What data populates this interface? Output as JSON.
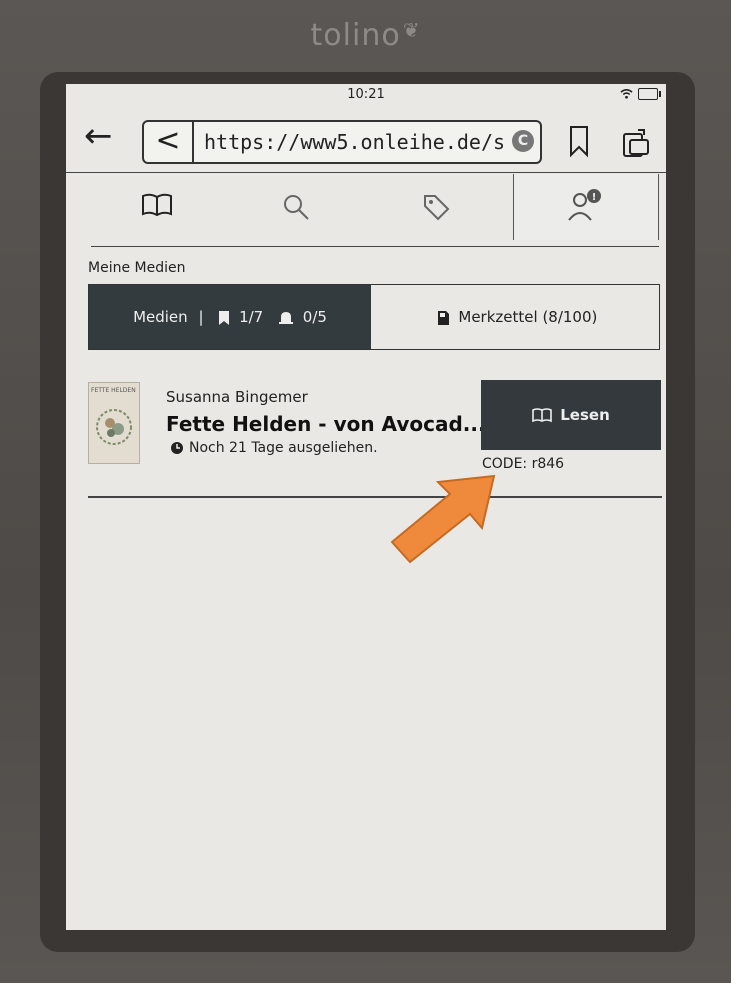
{
  "device": {
    "brand": "tolino"
  },
  "status": {
    "time": "10:21"
  },
  "browser": {
    "url": "https://www5.onleihe.de/s"
  },
  "nav": {
    "tabs": [
      "book",
      "search",
      "tag",
      "account"
    ],
    "active": "account"
  },
  "section": {
    "label": "Meine Medien"
  },
  "segments": {
    "left_label": "Medien",
    "left_sep": "|",
    "bookmarks_count": "1/7",
    "reservations_count": "0/5",
    "right_label": "Merkzettel (8/100)"
  },
  "media_item": {
    "cover_text": "FETTE HELDEN",
    "author": "Susanna Bingemer",
    "title": "Fette Helden - von Avocad...",
    "due_text": "Noch 21 Tage ausgeliehen.",
    "read_label": "Lesen",
    "code_text": "CODE: r846"
  },
  "colors": {
    "screen": "#e9e8e4",
    "dark_button": "#33393d",
    "annotation_arrow": "#ef8a3c"
  }
}
